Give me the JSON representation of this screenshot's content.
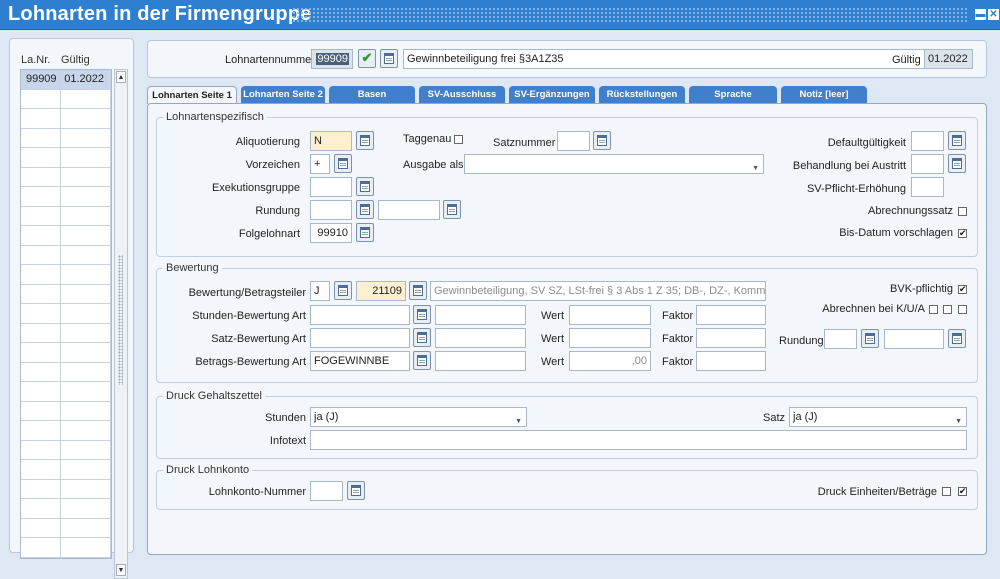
{
  "window": {
    "title": "Lohnarten in der Firmengruppe",
    "min_glyph": "▬",
    "close_glyph": "✕"
  },
  "left_list": {
    "col1": "La.Nr.",
    "col2": "Gültig",
    "rows": [
      {
        "nr": "99909",
        "gueltig": "01.2022"
      }
    ],
    "scroll_up": "▲",
    "scroll_down": "▼"
  },
  "header": {
    "lohnartennummer_label": "Lohnartennummer",
    "lohnartennummer": "99909",
    "description": "Gewinnbeteiligung frei §3A1Z35",
    "gueltig_label": "Gültig",
    "gueltig": "01.2022",
    "ok_glyph": "✔"
  },
  "tabs": [
    "Lohnarten Seite 1",
    "Lohnarten Seite 2",
    "Basen",
    "SV-Ausschluss",
    "SV-Ergänzungen",
    "Rückstellungen",
    "Sprache",
    "Notiz [leer]"
  ],
  "spez": {
    "title": "Lohnartenspezifisch",
    "aliquotierung_label": "Aliquotierung",
    "aliquotierung": "N",
    "vorzeichen_label": "Vorzeichen",
    "vorzeichen": "+",
    "exekution_label": "Exekutionsgruppe",
    "rundung_label": "Rundung",
    "folgelohnart_label": "Folgelohnart",
    "folgelohnart": "99910",
    "taggenau_label": "Taggenau",
    "satznummer_label": "Satznummer",
    "ausgabe_label": "Ausgabe als",
    "defaultgueltigkeit_label": "Defaultgültigkeit",
    "austritt_label": "Behandlung bei Austritt",
    "svpflicht_label": "SV-Pflicht-Erhöhung",
    "abrechnungssatz_label": "Abrechnungssatz",
    "bisdatum_label": "Bis-Datum vorschlagen",
    "bisdatum_check": "✔"
  },
  "bewertung": {
    "title": "Bewertung",
    "betragsteiler_label": "Bewertung/Betragsteiler",
    "betragsteiler": "J",
    "code": "21109",
    "code_desc": "Gewinnbeteiligung, SV SZ, LSt-frei § 3 Abs 1 Z 35; DB-, DZ-, KommSt",
    "stunden_label": "Stunden-Bewertung Art",
    "satz_label": "Satz-Bewertung Art",
    "betrag_label": "Betrags-Bewertung Art",
    "betrag": "FOGEWINNBE",
    "wert_label": "Wert",
    "faktor_label": "Faktor",
    "wert3": ",00",
    "bvk_label": "BVK-pflichtig",
    "bvk_check": "✔",
    "kua_label": "Abrechnen bei K/U/A",
    "rundung_label": "Rundung"
  },
  "druck_gehalt": {
    "title": "Druck Gehaltszettel",
    "stunden_label": "Stunden",
    "stunden": "ja (J)",
    "satz_label": "Satz",
    "satz": "ja (J)",
    "infotext_label": "Infotext"
  },
  "druck_lohn": {
    "title": "Druck Lohnkonto",
    "nummer_label": "Lohnkonto-Nummer",
    "einheiten_label": "Druck Einheiten/Beträge",
    "einheiten_check": "✔"
  }
}
